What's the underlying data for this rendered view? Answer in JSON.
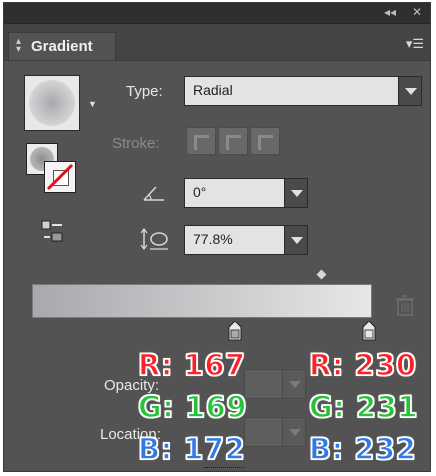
{
  "panel": {
    "tab_label": "Gradient",
    "collapse_icon": "double-chevron-left-icon",
    "close_icon": "close-icon",
    "menu_icon": "panel-menu-icon"
  },
  "gradient": {
    "type_label": "Type:",
    "type_value": "Radial",
    "stroke_label": "Stroke:",
    "angle_value": "0°",
    "aspect_value": "77.8%",
    "opacity_label": "Opacity:",
    "location_label": "Location:"
  },
  "stops": {
    "left": {
      "r_label": "R: 167",
      "g_label": "G: 169",
      "b_label": "B: 172",
      "color": "#a7a9ac"
    },
    "right": {
      "r_label": "R: 230",
      "g_label": "G: 231",
      "b_label": "B: 232",
      "color": "#e6e7e8"
    }
  },
  "colors": {
    "panel_bg": "#535353",
    "red_annotation": "#ff1f26",
    "green_annotation": "#27c23a",
    "blue_annotation": "#2f7ae8"
  }
}
